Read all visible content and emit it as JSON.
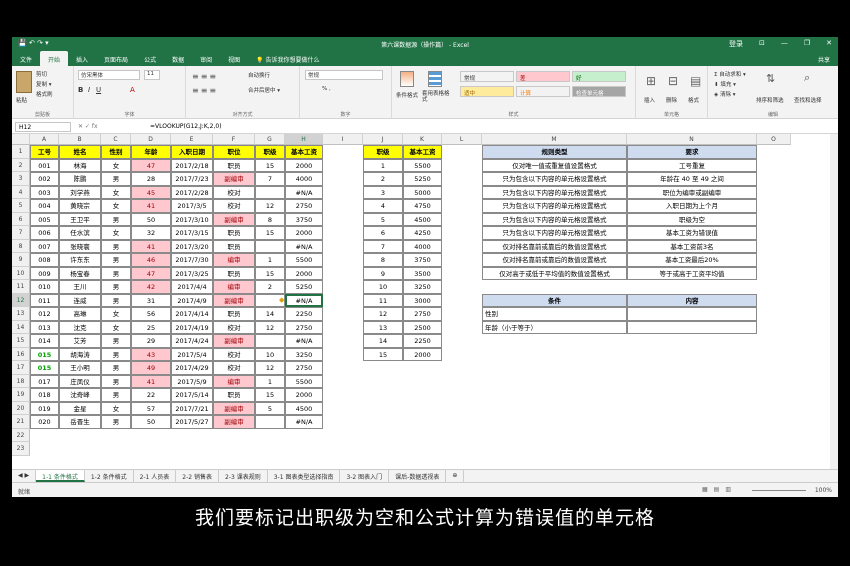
{
  "window": {
    "title": "第六课数据源（操作篇） - Excel",
    "user": "登录",
    "controls": [
      "⊡",
      "—",
      "❐",
      "✕"
    ]
  },
  "qat": "💾 ↶ ↷ ▾",
  "tabs": [
    "文件",
    "开始",
    "插入",
    "页面布局",
    "公式",
    "数据",
    "审阅",
    "视图",
    "💡 告诉我你想要做什么"
  ],
  "share": "共享",
  "ribbon": {
    "clipboard": {
      "cut": "剪切",
      "copy": "复制 ▾",
      "painter": "格式刷",
      "paste": "粘贴",
      "label": "剪贴板"
    },
    "font": {
      "name": "仿宋黑体",
      "size": "11",
      "label": "字体"
    },
    "align": {
      "wrap": "自动换行",
      "merge": "合并后居中 ▾",
      "label": "对齐方式"
    },
    "number": {
      "fmt": "常规",
      "pct": "% ,",
      "label": "数字"
    },
    "styles": {
      "cond": "条件格式",
      "table": "套用表格格式",
      "cells": [
        {
          "label": "常规",
          "bg": "#ffffff",
          "fg": "#000000"
        },
        {
          "label": "差",
          "bg": "#ffc7ce",
          "fg": "#9c0006"
        },
        {
          "label": "好",
          "bg": "#c6efce",
          "fg": "#006100"
        },
        {
          "label": "适中",
          "bg": "#ffeb9c",
          "fg": "#9c6500"
        },
        {
          "label": "计算",
          "bg": "#f2f2f2",
          "fg": "#fa7d00"
        },
        {
          "label": "检查单元格",
          "bg": "#a5a5a5",
          "fg": "#ffffff"
        }
      ],
      "label": "样式"
    },
    "cellsgrp": {
      "insert": "插入",
      "delete": "删除",
      "format": "格式",
      "label": "单元格"
    },
    "editing": {
      "autosum": "Σ 自动求和 ▾",
      "fill": "⬇ 填充 ▾",
      "clear": "◈ 清除 ▾",
      "sort": "排序和筛选",
      "find": "查找和选择",
      "label": "编辑"
    }
  },
  "formula_bar": {
    "name_box": "H12",
    "fx": "✕ ✓ fx",
    "formula": "=VLOOKUP(G12,J:K,2,0)"
  },
  "columns": [
    "A",
    "B",
    "C",
    "D",
    "E",
    "F",
    "G",
    "H",
    "I",
    "J",
    "K",
    "L",
    "M",
    "N",
    "O"
  ],
  "rows": [
    "1",
    "2",
    "3",
    "4",
    "5",
    "6",
    "7",
    "8",
    "9",
    "10",
    "11",
    "12",
    "13",
    "14",
    "15",
    "16",
    "17",
    "18",
    "19",
    "20",
    "21",
    "22",
    "23"
  ],
  "table": {
    "headers": [
      "工号",
      "姓名",
      "性别",
      "年龄",
      "入职日期",
      "职位",
      "职级",
      "基本工资"
    ],
    "rows": [
      [
        "001",
        "林海",
        "女",
        "47",
        "2017/2/18",
        "职员",
        "15",
        "2000"
      ],
      [
        "002",
        "陈鹏",
        "男",
        "28",
        "2017/7/23",
        "副编审",
        "7",
        "4000"
      ],
      [
        "003",
        "刘学燕",
        "女",
        "45",
        "2017/2/28",
        "校对",
        "",
        "#N/A"
      ],
      [
        "004",
        "黄晓宗",
        "女",
        "41",
        "2017/3/5",
        "校对",
        "12",
        "2750"
      ],
      [
        "005",
        "王卫平",
        "男",
        "50",
        "2017/3/10",
        "副编审",
        "8",
        "3750"
      ],
      [
        "006",
        "任水滨",
        "女",
        "32",
        "2017/3/15",
        "职员",
        "15",
        "2000"
      ],
      [
        "007",
        "张晓寰",
        "男",
        "41",
        "2017/3/20",
        "职员",
        "",
        "#N/A"
      ],
      [
        "008",
        "许东东",
        "男",
        "46",
        "2017/7/30",
        "编审",
        "1",
        "5500"
      ],
      [
        "009",
        "杨宝春",
        "男",
        "47",
        "2017/3/25",
        "职员",
        "15",
        "2000"
      ],
      [
        "010",
        "王川",
        "男",
        "42",
        "2017/4/4",
        "编审",
        "2",
        "5250"
      ],
      [
        "011",
        "连威",
        "男",
        "31",
        "2017/4/9",
        "副编审",
        "",
        "#N/A"
      ],
      [
        "012",
        "高琳",
        "女",
        "56",
        "2017/4/14",
        "职员",
        "14",
        "2250"
      ],
      [
        "013",
        "沈克",
        "女",
        "25",
        "2017/4/19",
        "校对",
        "12",
        "2750"
      ],
      [
        "014",
        "艾芳",
        "男",
        "29",
        "2017/4/24",
        "副编审",
        "",
        "#N/A"
      ],
      [
        "015",
        "胡海涛",
        "男",
        "43",
        "2017/5/4",
        "校对",
        "10",
        "3250"
      ],
      [
        "015",
        "王小明",
        "男",
        "49",
        "2017/4/29",
        "校对",
        "12",
        "2750"
      ],
      [
        "017",
        "庄凤仪",
        "男",
        "41",
        "2017/5/9",
        "编审",
        "1",
        "5500"
      ],
      [
        "018",
        "沈奇峰",
        "男",
        "22",
        "2017/5/14",
        "职员",
        "15",
        "2000"
      ],
      [
        "019",
        "金星",
        "女",
        "57",
        "2017/7/21",
        "副编审",
        "5",
        "4500"
      ],
      [
        "020",
        "岳晋生",
        "男",
        "50",
        "2017/5/27",
        "副编审",
        "",
        "#N/A"
      ]
    ]
  },
  "lookup": {
    "headers": [
      "职级",
      "基本工资"
    ],
    "rows": [
      [
        "1",
        "5500"
      ],
      [
        "2",
        "5250"
      ],
      [
        "3",
        "5000"
      ],
      [
        "4",
        "4750"
      ],
      [
        "5",
        "4500"
      ],
      [
        "6",
        "4250"
      ],
      [
        "7",
        "4000"
      ],
      [
        "8",
        "3750"
      ],
      [
        "9",
        "3500"
      ],
      [
        "10",
        "3250"
      ],
      [
        "11",
        "3000"
      ],
      [
        "12",
        "2750"
      ],
      [
        "13",
        "2500"
      ],
      [
        "14",
        "2250"
      ],
      [
        "15",
        "2000"
      ]
    ]
  },
  "rules": {
    "headers": [
      "规则类型",
      "要求"
    ],
    "rows": [
      [
        "仅对唯一值或重复值设置格式",
        "工号重复"
      ],
      [
        "只为包含以下内容的单元格设置格式",
        "年龄在 40 至 49 之间"
      ],
      [
        "只为包含以下内容的单元格设置格式",
        "职位为编审或副编审"
      ],
      [
        "只为包含以下内容的单元格设置格式",
        "入职日期为上个月"
      ],
      [
        "只为包含以下内容的单元格设置格式",
        "职级为空"
      ],
      [
        "只为包含以下内容的单元格设置格式",
        "基本工资为错误值"
      ],
      [
        "仅对排名靠前或靠后的数值设置格式",
        "基本工资前3名"
      ],
      [
        "仅对排名靠前或靠后的数值设置格式",
        "基本工资最后20%"
      ],
      [
        "仅对高于或低于平均值的数值设置格式",
        "等于或高于工资平均值"
      ]
    ]
  },
  "conditions": {
    "headers": [
      "条件",
      "内容"
    ],
    "rows": [
      [
        "性别",
        ""
      ],
      [
        "年龄（小于等于）",
        ""
      ]
    ]
  },
  "sheet_tabs": [
    "1-1 条件格式",
    "1-2 条件格式",
    "2-1 人员表",
    "2-2 销售表",
    "2-3 课表规则",
    "3-1 图表类型选择指南",
    "3-2 图表入门",
    "课后-数据透视表"
  ],
  "status": {
    "ready": "就绪",
    "zoom": "100%"
  },
  "subtitle": "我们要标记出职级为空和公式计算为错误值的单元格"
}
